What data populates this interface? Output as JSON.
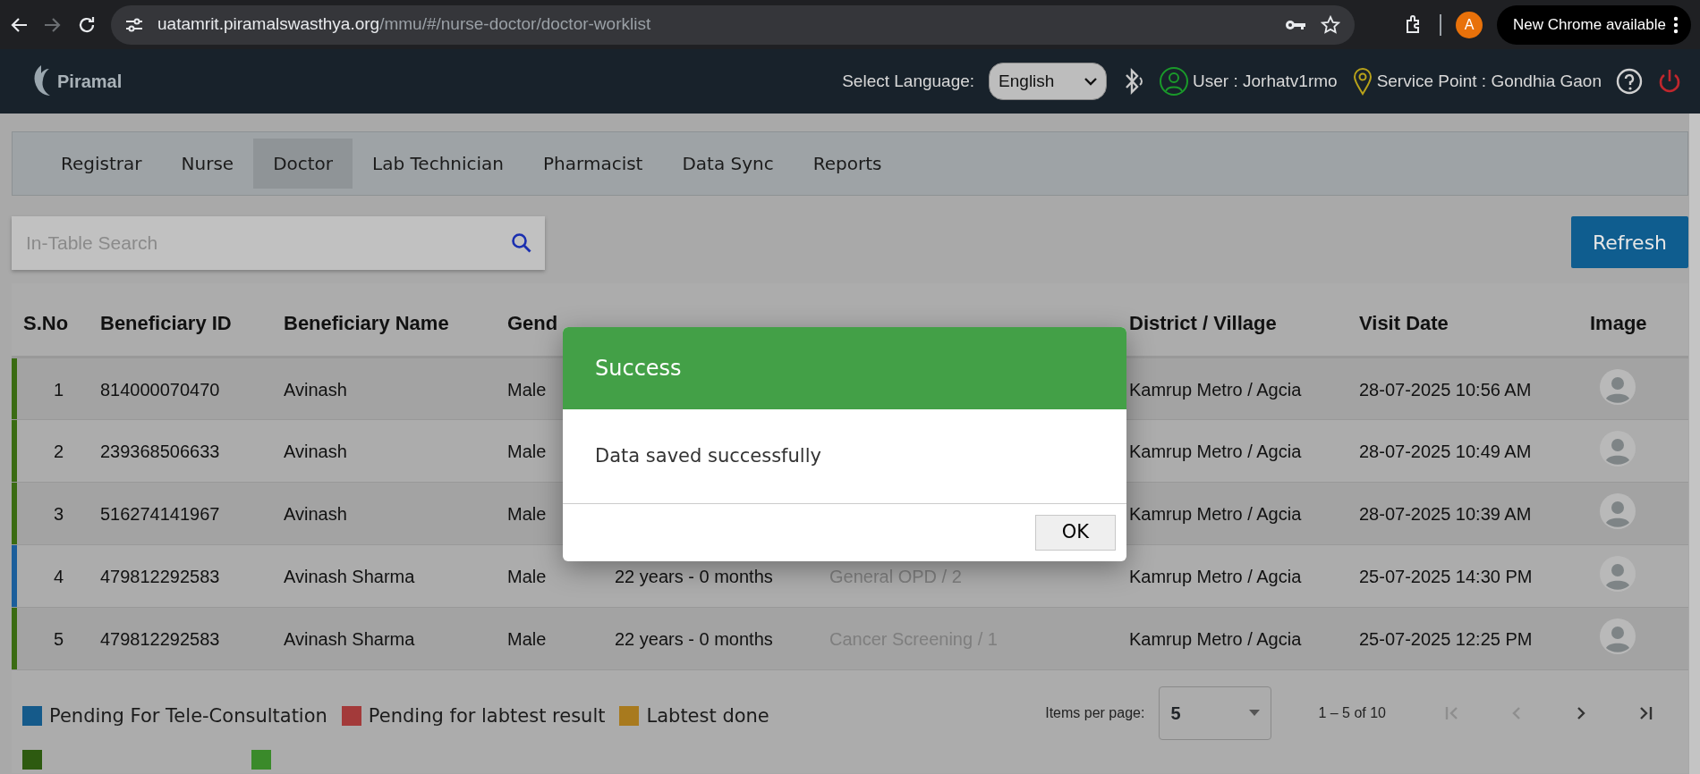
{
  "browser": {
    "url_host": "uatamrit.piramalswasthya.org",
    "url_path": "/mmu/#/nurse-doctor/doctor-worklist",
    "forward_disabled": true,
    "profile_initial": "A",
    "update_button": "New Chrome available"
  },
  "header": {
    "logo": "Piramal",
    "language_label": "Select Language:",
    "language": "English",
    "user": "User : Jorhatv1rmo",
    "service_point": "Service Point : Gondhia Gaon"
  },
  "tabs": [
    {
      "label": "Registrar",
      "selected": false
    },
    {
      "label": "Nurse",
      "selected": false
    },
    {
      "label": "Doctor",
      "selected": true
    },
    {
      "label": "Lab Technician",
      "selected": false
    },
    {
      "label": "Pharmacist",
      "selected": false
    },
    {
      "label": "Data Sync",
      "selected": false
    },
    {
      "label": "Reports",
      "selected": false
    }
  ],
  "search": {
    "placeholder": "In-Table Search"
  },
  "refresh_button": "Refresh",
  "table": {
    "columns": [
      {
        "label": "S.No"
      },
      {
        "label": "Beneficiary ID"
      },
      {
        "label": "Beneficiary Name"
      },
      {
        "label": "Gend"
      },
      {},
      {},
      {
        "label": "District / Village"
      },
      {
        "label": "Visit Date"
      },
      {
        "label": "Image"
      }
    ],
    "rows": [
      {
        "color": "#3a6b12",
        "cells": [
          "1",
          "814000070470",
          "Avinash",
          "Male",
          null,
          null,
          "Kamrup Metro / Agcia",
          "28-07-2025 10:56 AM"
        ]
      },
      {
        "color": "#3a6b12",
        "cells": [
          "2",
          "239368506633",
          "Avinash",
          "Male",
          null,
          null,
          "Kamrup Metro / Agcia",
          "28-07-2025 10:49 AM"
        ]
      },
      {
        "color": "#3a6b12",
        "cells": [
          "3",
          "516274141967",
          "Avinash",
          "Male",
          null,
          null,
          "Kamrup Metro / Agcia",
          "28-07-2025 10:39 AM"
        ]
      },
      {
        "color": "#1b5e9b",
        "cells": [
          "4",
          "479812292583",
          "Avinash Sharma",
          "Male",
          "22 years - 0 months",
          "General OPD / 2",
          "Kamrup Metro / Agcia",
          "25-07-2025 14:30 PM"
        ]
      },
      {
        "color": "#3a6b12",
        "cells": [
          "5",
          "479812292583",
          "Avinash Sharma",
          "Male",
          "22 years - 0 months",
          "Cancer Screening / 1",
          "Kamrup Metro / Agcia",
          "25-07-2025 12:25 PM"
        ]
      }
    ]
  },
  "legend": [
    {
      "label": "Pending For Tele-Consultation",
      "color": "#155a8a"
    },
    {
      "label": "Pending for labtest result",
      "color": "#a33a3a"
    },
    {
      "label": "Labtest done",
      "color": "#a87a1e"
    },
    {
      "color": "#2d5a10"
    },
    {
      "color": "#3a8a2a"
    }
  ],
  "pagination": {
    "label": "Items per page:",
    "page_size": "5",
    "range": "1 – 5 of 10",
    "first_disabled": true,
    "previous_disabled": true,
    "next_disabled": false,
    "last_disabled": false
  },
  "modal": {
    "title": "Success",
    "message": "Data saved successfully",
    "ok_button": "OK"
  }
}
